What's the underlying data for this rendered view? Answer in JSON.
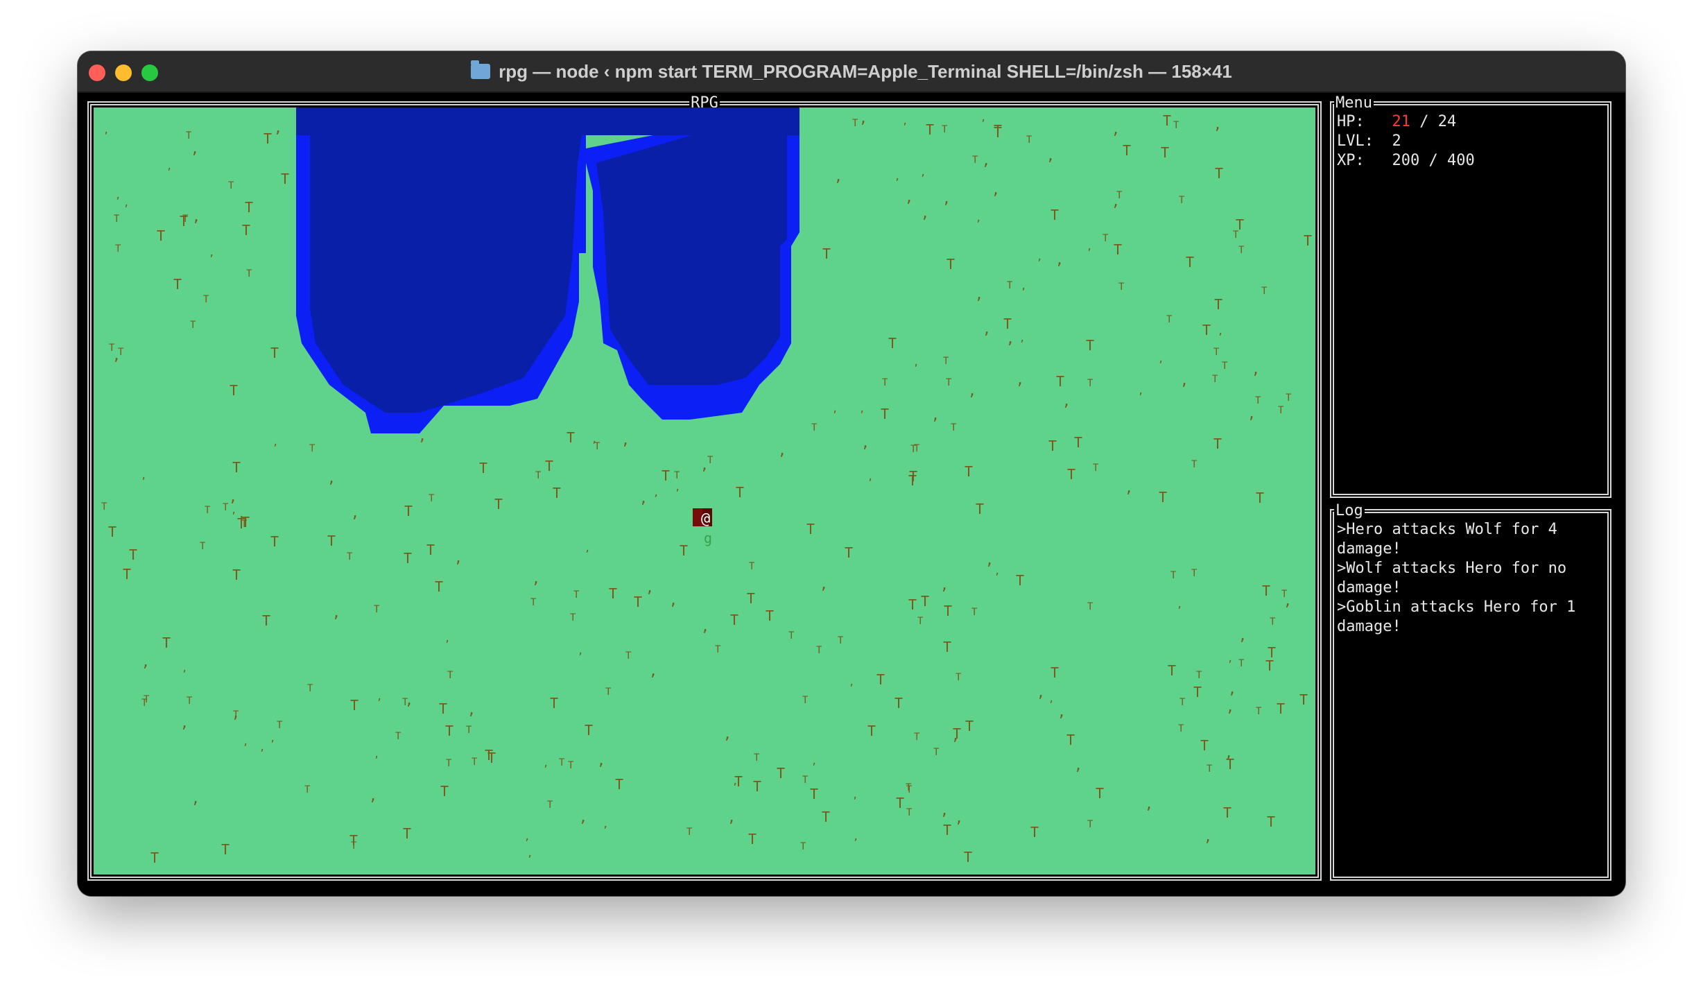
{
  "window": {
    "title": "rpg — node ‹ npm start TERM_PROGRAM=Apple_Terminal SHELL=/bin/zsh — 158×41",
    "folder_icon": "folder-icon"
  },
  "map": {
    "title": "RPG",
    "colors": {
      "grass": "#5fd38c",
      "water_deep": "#0a1fa8",
      "water_edge": "#0c1ff5",
      "tree": "#7a5a1a"
    },
    "player_glyph": "@",
    "enemy_glyph": "g",
    "tree_glyph": "T"
  },
  "menu": {
    "title": "Menu",
    "hp_label": "HP:",
    "hp_current": "21",
    "hp_sep_max": " / 24",
    "lvl_label": "LVL:",
    "lvl_value": "2",
    "xp_label": "XP:",
    "xp_value": "200 / 400"
  },
  "log": {
    "title": "Log",
    "lines": [
      ">Hero attacks Wolf for 4 damage!",
      ">Wolf attacks Hero for no damage!",
      ">Goblin attacks Hero for 1 damage!"
    ]
  }
}
